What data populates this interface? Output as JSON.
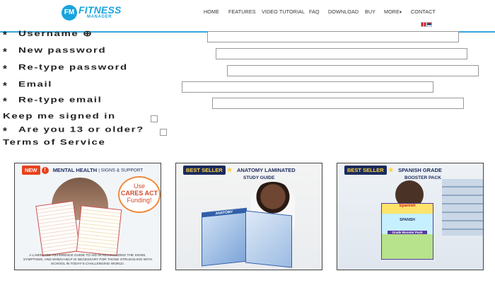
{
  "header": {
    "logo_text": "FITNESS",
    "logo_badge": "FM",
    "logo_sub": "manager",
    "nav": [
      "HOME",
      "FEATURES",
      "VIDEO TUTORIAL",
      "FAQ",
      "DOWNLOAD",
      "BUY",
      "MORE",
      "CONTACT"
    ],
    "more_caret": "▾"
  },
  "form": {
    "required_marker": "*",
    "fields": [
      {
        "label": "Username",
        "icon": "info-icon"
      },
      {
        "label": "New password"
      },
      {
        "label": "Re-type password"
      },
      {
        "label": "Email"
      },
      {
        "label": "Re-type email"
      }
    ],
    "keep_signed_in": "Keep me signed in",
    "age_question": "Are you 13 or older?",
    "terms": "Terms of Service"
  },
  "ads": [
    {
      "tag": "NEW",
      "title": "MENTAL HEALTH",
      "subtitle": "| SIGNS & SUPPORT",
      "callout_line1": "Use",
      "callout_line2": "CARES ACT",
      "callout_line3": "Funding!",
      "caption": "A laminated reference guide to aid in recognizing the signs, symptoms, and when help is necessary for those struggling with school in today's challenging world.",
      "accent": "#e8421d"
    },
    {
      "tag": "BEST SELLER",
      "title": "ANATOMY LAMINATED",
      "subtitle": "STUDY GUIDE",
      "sheet_label": "ANATOMY",
      "accent": "#1b2b5c"
    },
    {
      "tag": "BEST SELLER",
      "title": "SPANISH GRADE",
      "subtitle": "BOOSTER PACK",
      "sheet_label1": "Spanish",
      "sheet_label2": "SPANISH",
      "sheet_label3": "Grade Booster Pack",
      "accent": "#1b2b5c"
    }
  ],
  "colors": {
    "brand": "#1aa3dd",
    "header_border": "#39a9e0",
    "label_text": "#222222"
  }
}
